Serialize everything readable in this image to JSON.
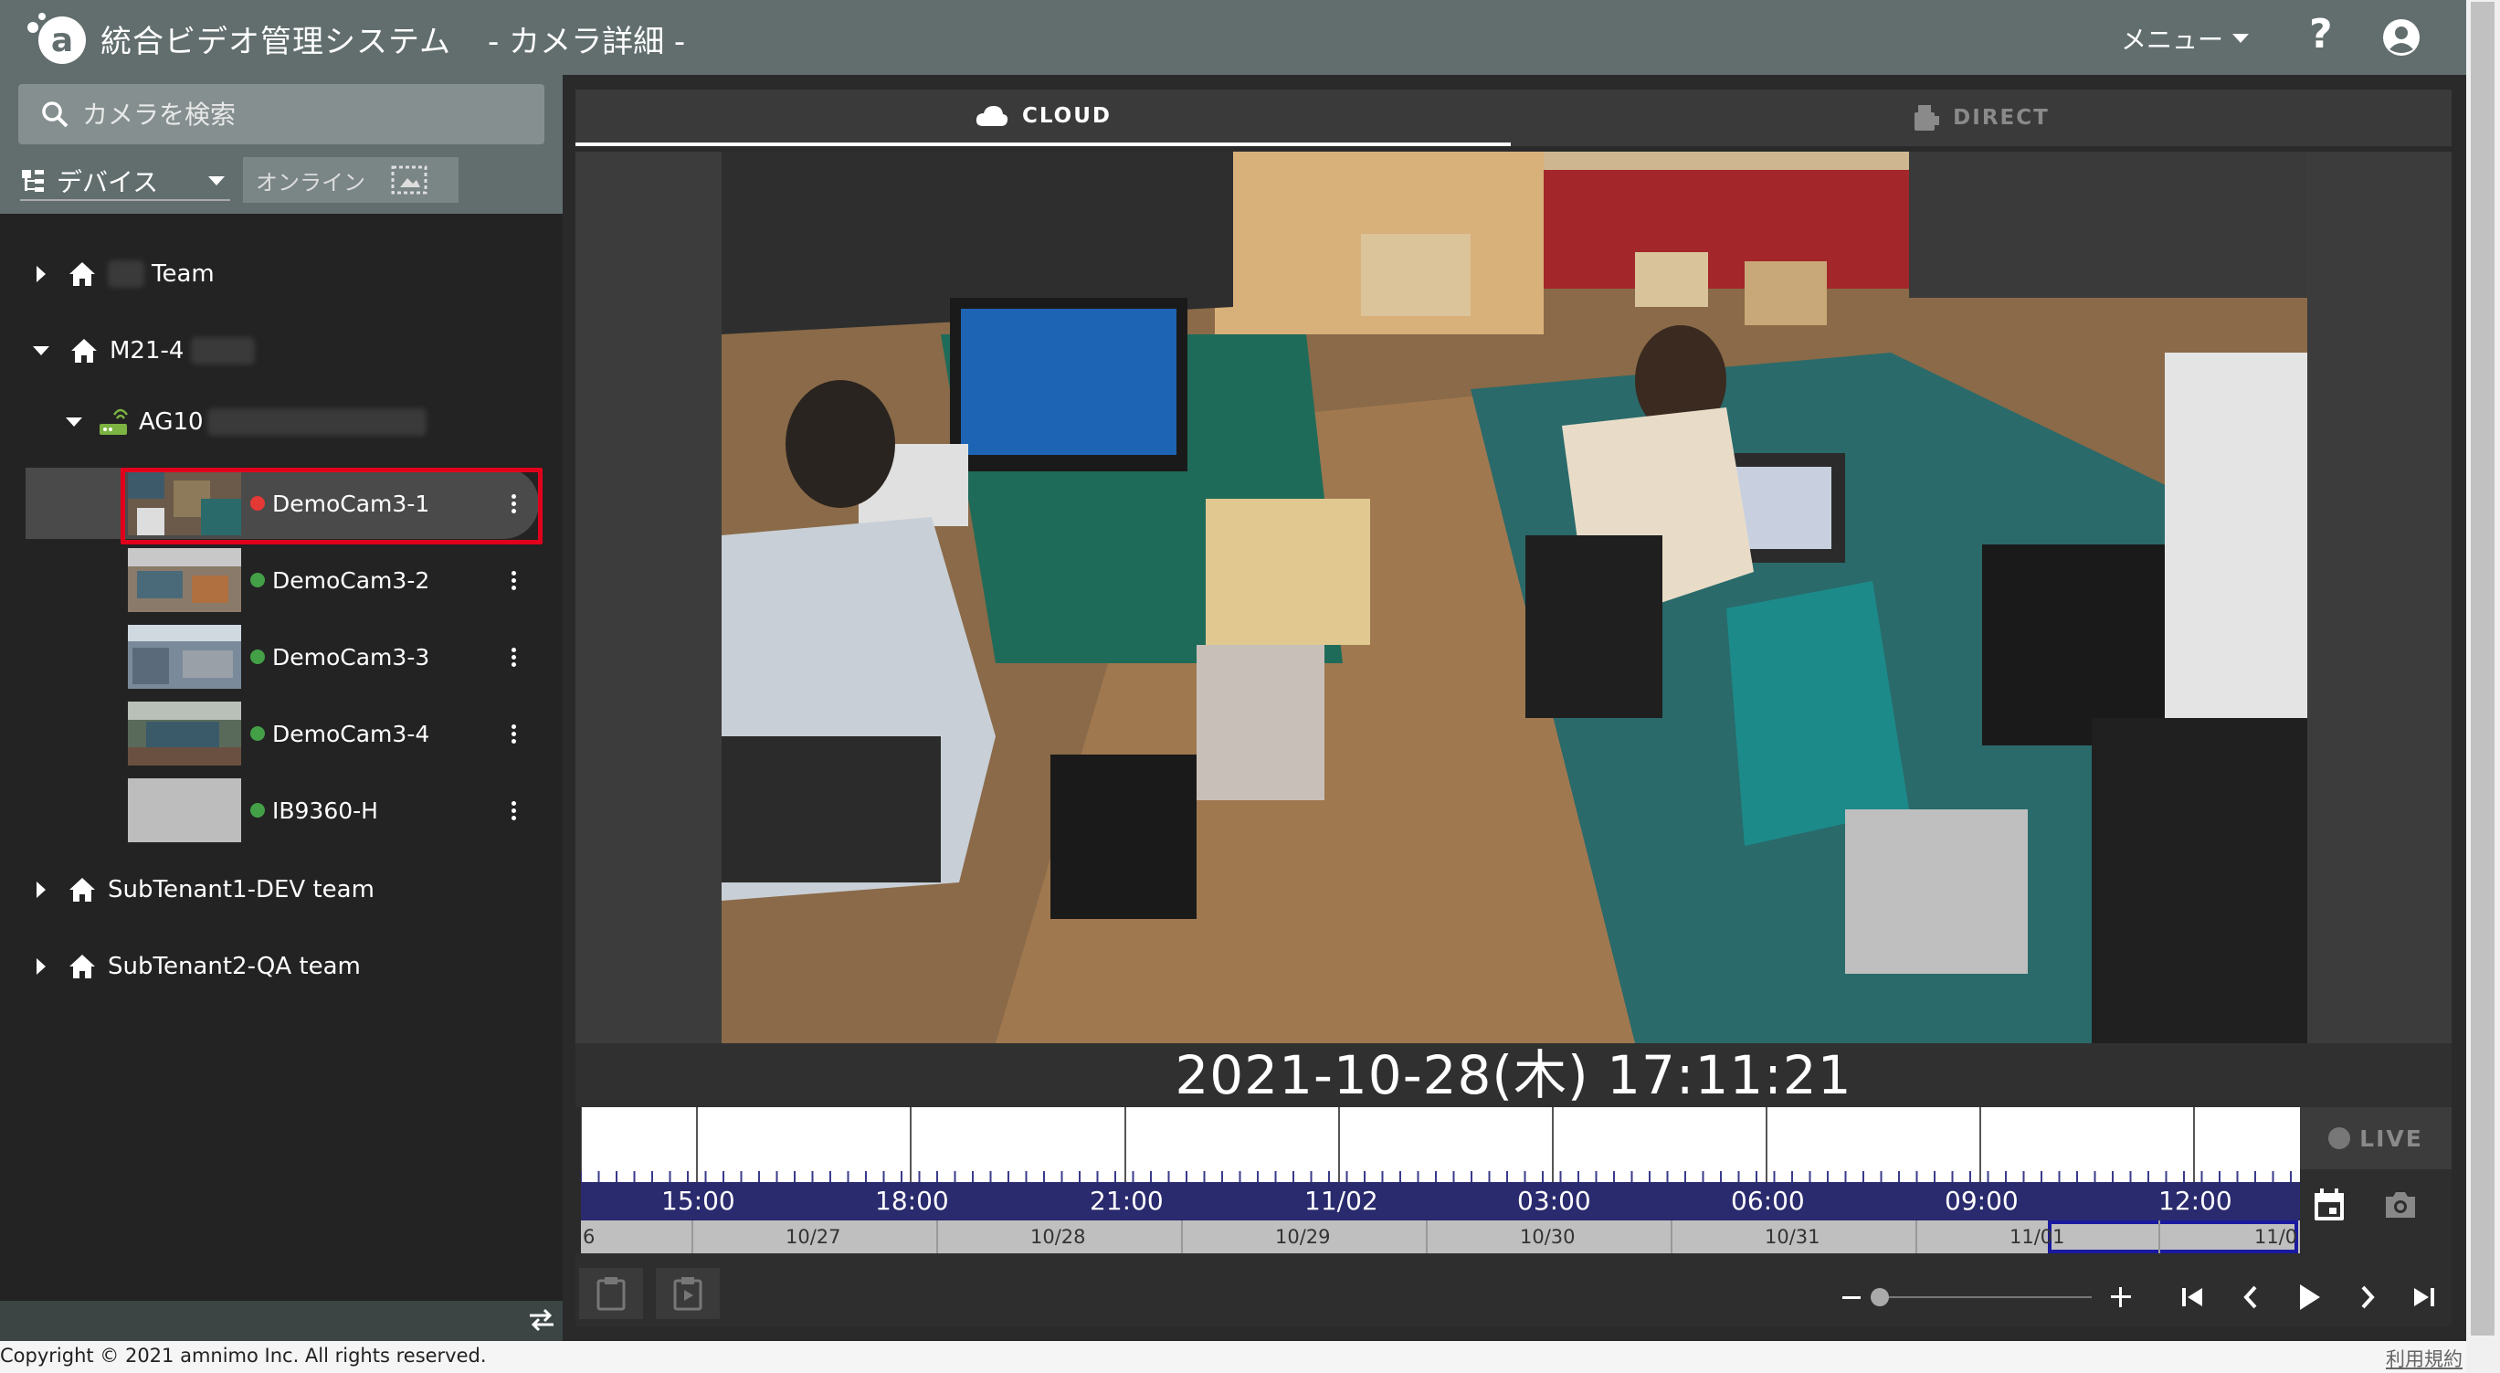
{
  "header": {
    "app_title": "統合ビデオ管理システム",
    "page_subtitle": "- カメラ詳細 -",
    "menu_label": "メニュー",
    "help_label": "?"
  },
  "sidebar": {
    "search_placeholder": "カメラを検索",
    "device_select_value": "デバイス",
    "online_filter_label": "オンライン",
    "tree": {
      "group1": "Team",
      "group2": "M21-4",
      "gateway": "AG10",
      "cameras": [
        {
          "label": "DemoCam3-1",
          "status_color": "#e53935"
        },
        {
          "label": "DemoCam3-2",
          "status_color": "#43a047"
        },
        {
          "label": "DemoCam3-3",
          "status_color": "#43a047"
        },
        {
          "label": "DemoCam3-4",
          "status_color": "#43a047"
        },
        {
          "label": "IB9360-H",
          "status_color": "#43a047"
        }
      ],
      "group3": "SubTenant1-DEV team",
      "group4": "SubTenant2-QA team"
    }
  },
  "tabs": {
    "cloud_label": "CLOUD",
    "direct_label": "DIRECT"
  },
  "player": {
    "timestamp": "2021-10-28(木) 17:11:21",
    "live_label": "LIVE"
  },
  "timeline": {
    "hour_labels": [
      "15:00",
      "18:00",
      "21:00",
      "11/02",
      "03:00",
      "06:00",
      "09:00",
      "12:00"
    ],
    "day_labels": [
      "6",
      "10/27",
      "10/28",
      "10/29",
      "10/30",
      "10/31",
      "11/01",
      "11/0"
    ]
  },
  "footer": {
    "copyright": "Copyright © 2021 amnimo Inc. All rights reserved.",
    "terms": "利用規約"
  },
  "colors": {
    "header_bg": "#626e6e",
    "selection_border": "#e0001b",
    "timeline_hours_bg": "#2a2a6e"
  }
}
